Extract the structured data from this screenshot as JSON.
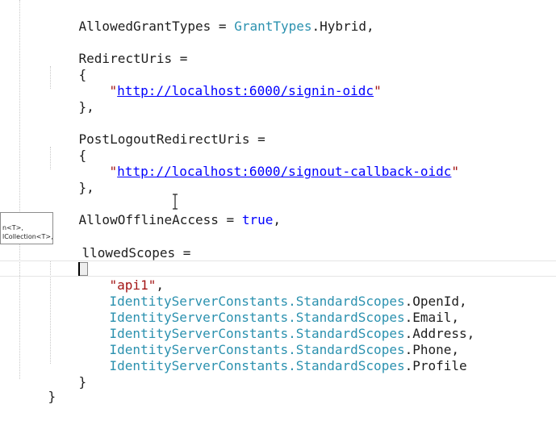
{
  "code": {
    "allowed_grant_types": {
      "name": "AllowedGrantTypes",
      "op": " = ",
      "type": "GrantTypes",
      "member": ".Hybrid,"
    },
    "redirect_uris": {
      "name": "RedirectUris =",
      "open_brace": "{",
      "quote_open": "\"",
      "url": "http://localhost:6000/signin-oidc",
      "quote_close": "\"",
      "close_brace": "},"
    },
    "post_logout_redirect_uris": {
      "name": "PostLogoutRedirectUris =",
      "open_brace": "{",
      "quote_open": "\"",
      "url": "http://localhost:6000/signout-callback-oidc",
      "quote_close": "\"",
      "close_brace": "},"
    },
    "allow_offline_access": {
      "name": "AllowOfflineAccess",
      "op": " = ",
      "value": "true",
      "end": ","
    },
    "allowed_scopes": {
      "name": "llowedScopes =",
      "open_brace": "{",
      "first_scope": "\"api1\"",
      "first_scope_end": ",",
      "constants_type": "IdentityServerConstants",
      "scopes_type": ".StandardScopes",
      "scopes": [
        ".OpenId,",
        ".Email,",
        ".Address,",
        ".Phone,",
        ".Profile"
      ],
      "close_brace": "}"
    },
    "outer_close_brace": "}"
  },
  "tooltip": {
    "line1": "n<T>,",
    "line2": "lCollection<T>,"
  }
}
